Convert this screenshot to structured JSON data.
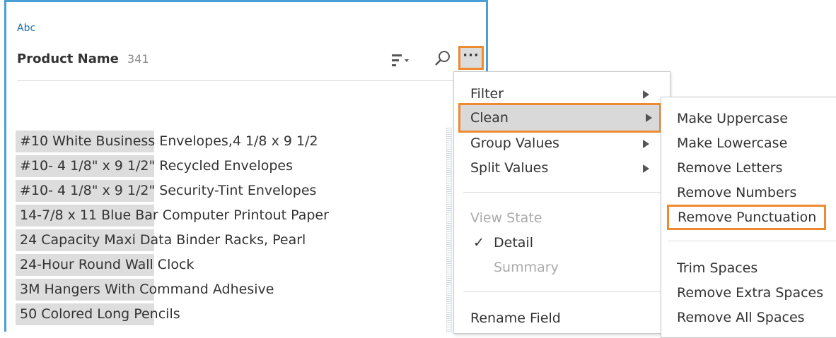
{
  "field": {
    "type": "Abc",
    "name": "Product Name",
    "count": "341"
  },
  "icons": {
    "sort": "sort-icon",
    "sort_dropdown": "chevron-down-icon",
    "search": "search-icon",
    "more": "more-options-icon"
  },
  "more_button_label": "···",
  "values": [
    {
      "text": "#10 White Business Envelopes,4 1/8 x 9 1/2",
      "bar_fraction": 0.327
    },
    {
      "text": "#10- 4 1/8\" x 9 1/2\" Recycled Envelopes",
      "bar_fraction": 0.327
    },
    {
      "text": "#10- 4 1/8\" x 9 1/2\" Security-Tint Envelopes",
      "bar_fraction": 0.327
    },
    {
      "text": "14-7/8 x 11 Blue Bar Computer Printout Paper",
      "bar_fraction": 0.327
    },
    {
      "text": "24 Capacity Maxi Data Binder Racks, Pearl",
      "bar_fraction": 0.327
    },
    {
      "text": "24-Hour Round Wall Clock",
      "bar_fraction": 0.327
    },
    {
      "text": "3M Hangers With Command Adhesive",
      "bar_fraction": 0.327
    },
    {
      "text": "50 Colored Long Pencils",
      "bar_fraction": 0.327
    }
  ],
  "menu": {
    "filter": "Filter",
    "clean": "Clean",
    "group_values": "Group Values",
    "split_values": "Split Values",
    "view_state": "View State",
    "check_mark": "✓",
    "detail": "Detail",
    "summary": "Summary",
    "rename_field": "Rename Field"
  },
  "submenu": {
    "make_uppercase": "Make Uppercase",
    "make_lowercase": "Make Lowercase",
    "remove_letters": "Remove Letters",
    "remove_numbers": "Remove Numbers",
    "remove_punctuation": "Remove Punctuation",
    "trim_spaces": "Trim Spaces",
    "remove_extra_spaces": "Remove Extra Spaces",
    "remove_all_spaces": "Remove All Spaces"
  },
  "colors": {
    "card_border": "#4a9fd4",
    "highlight_outline": "#ee8a30",
    "type_label": "#1f6fa6",
    "bar": "#dddddd"
  }
}
